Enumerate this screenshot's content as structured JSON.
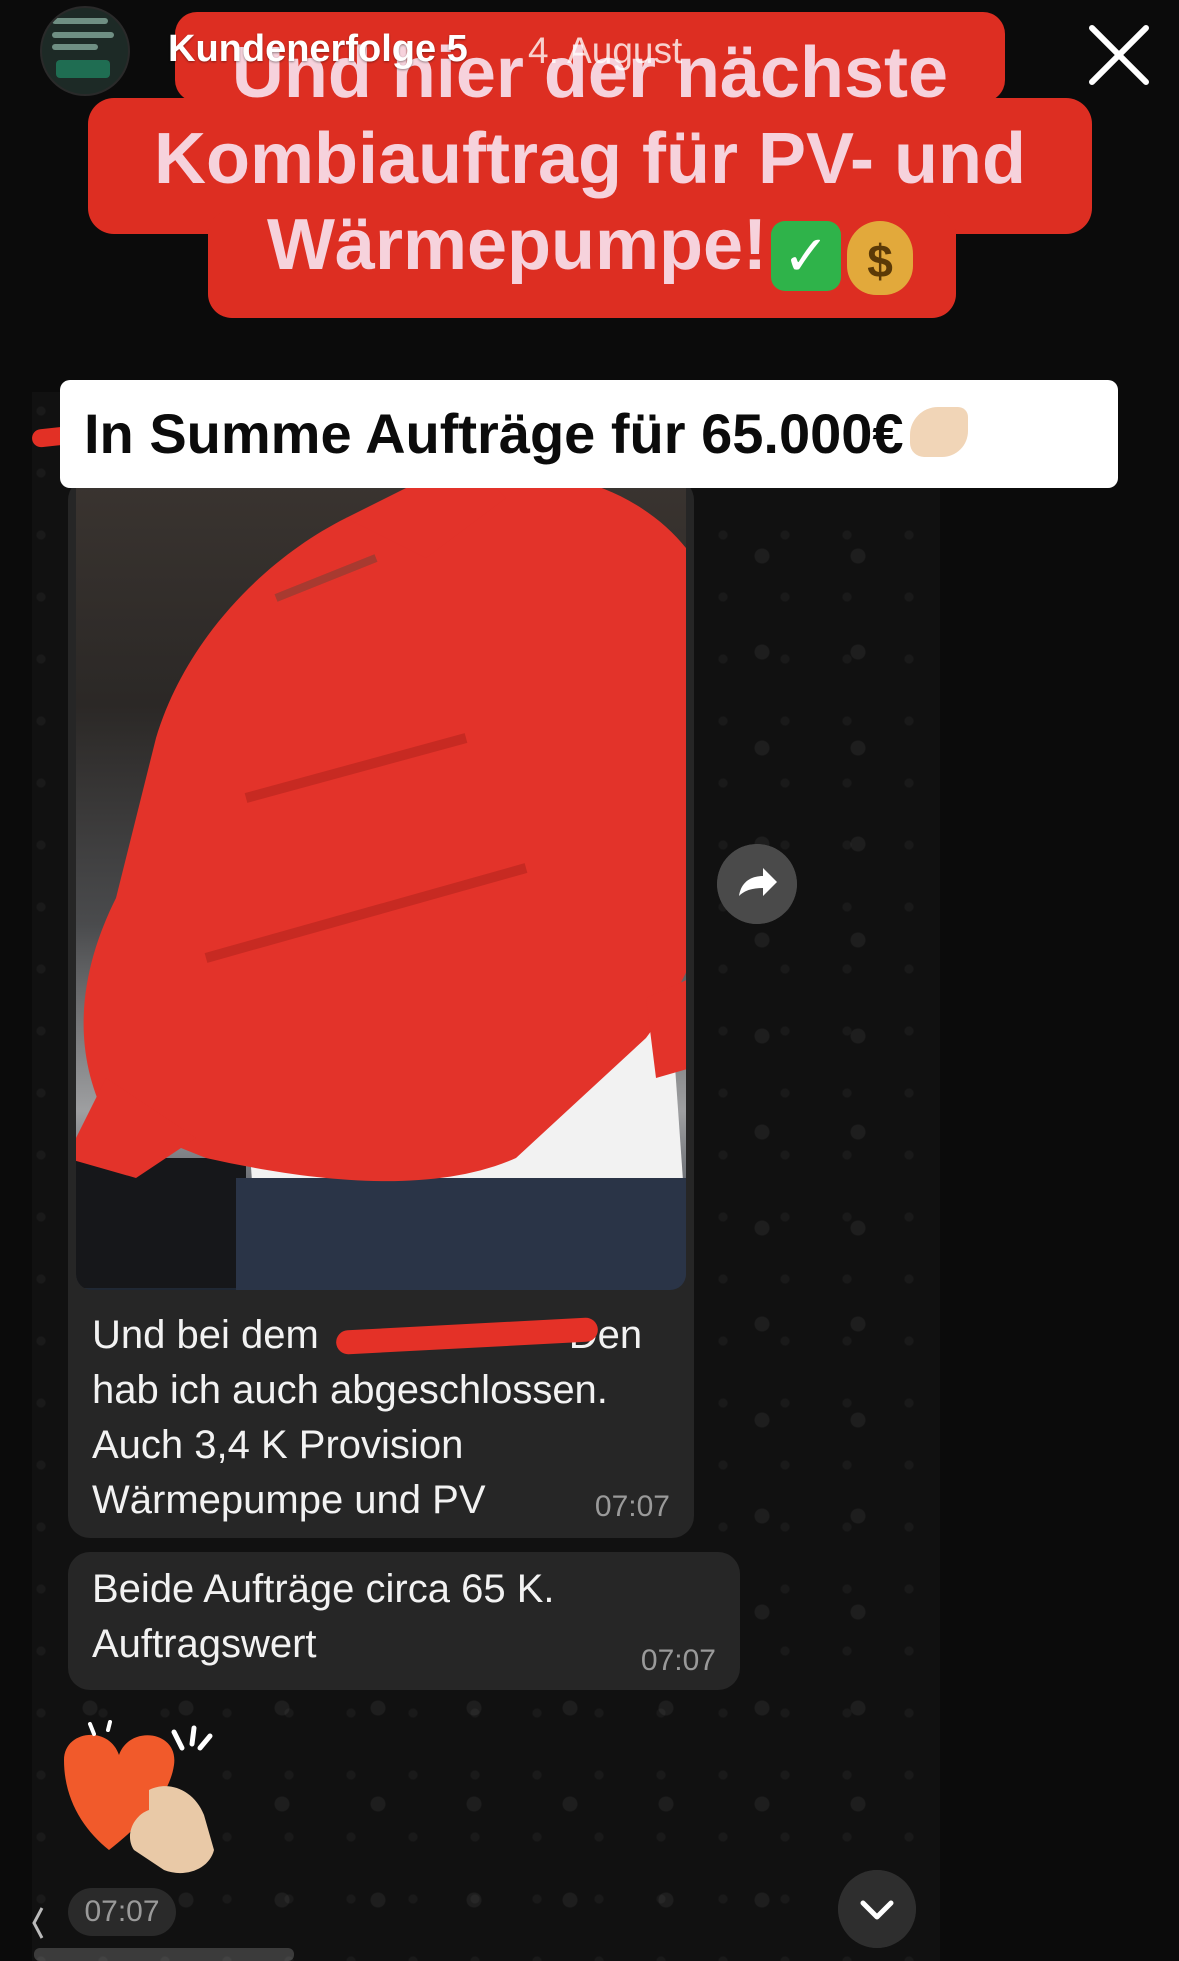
{
  "story": {
    "user": "Kundenerfolge 5",
    "date": "4. August",
    "close_icon": "close-icon"
  },
  "overlay": {
    "headline_line1": "Und hier der nächste",
    "headline_line2": "Kombiauftrag für PV- und",
    "headline_line3": "Wärmepumpe!",
    "check_emoji": "✓",
    "money_emoji": "$",
    "summary": "In Summe Aufträge für 65.000€",
    "accent": "#dd2e22"
  },
  "chat": {
    "messages": [
      {
        "line1_before": "Und bei dem",
        "line1_after": "Den",
        "line2": "hab ich auch abgeschlossen.",
        "line3": "Auch 3,4 K Provision",
        "line4": "Wärmepumpe und PV",
        "time": "07:07"
      },
      {
        "line1": "Beide Aufträge circa 65 K.",
        "line2": "Auftragswert",
        "time": "07:07"
      }
    ],
    "sticker_time": "07:07",
    "icons": {
      "forward": "forward-icon",
      "scroll": "chevron-down-icon",
      "sticker": "heart-hand-sticker"
    }
  }
}
